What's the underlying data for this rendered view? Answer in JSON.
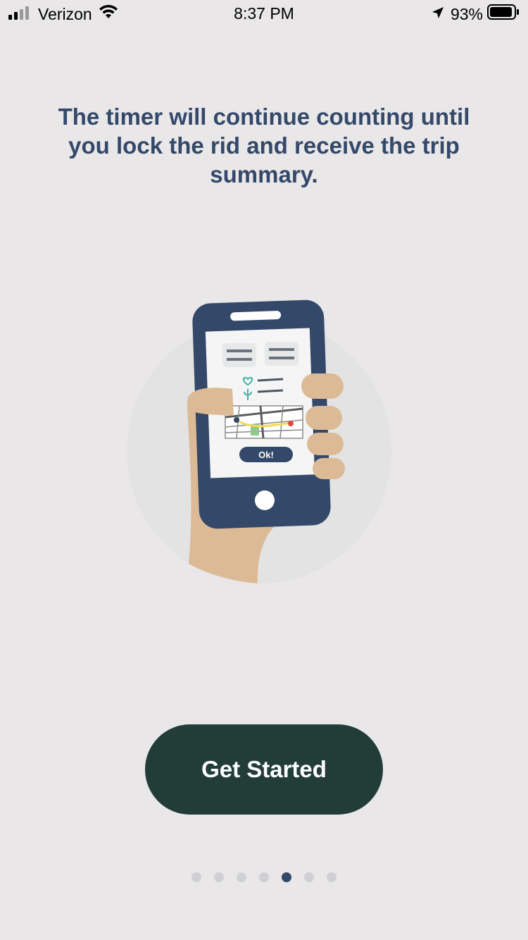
{
  "status_bar": {
    "carrier": "Verizon",
    "time": "8:37 PM",
    "battery": "93%",
    "icons": [
      "signal-icon",
      "wifi-icon",
      "location-arrow-icon",
      "battery-icon"
    ]
  },
  "onboarding": {
    "headline": "The timer will continue counting until you lock the rid and receive the trip summary.",
    "illustration": {
      "phone_button_label": "Ok!"
    },
    "cta_label": "Get Started",
    "pagination": {
      "total": 7,
      "current": 5
    }
  },
  "colors": {
    "background": "#e9e7e8",
    "headline": "#34496a",
    "cta_background": "#223d38",
    "cta_text": "#ffffff",
    "dot_active": "#34496a",
    "dot_inactive": "#cfd0d4"
  }
}
